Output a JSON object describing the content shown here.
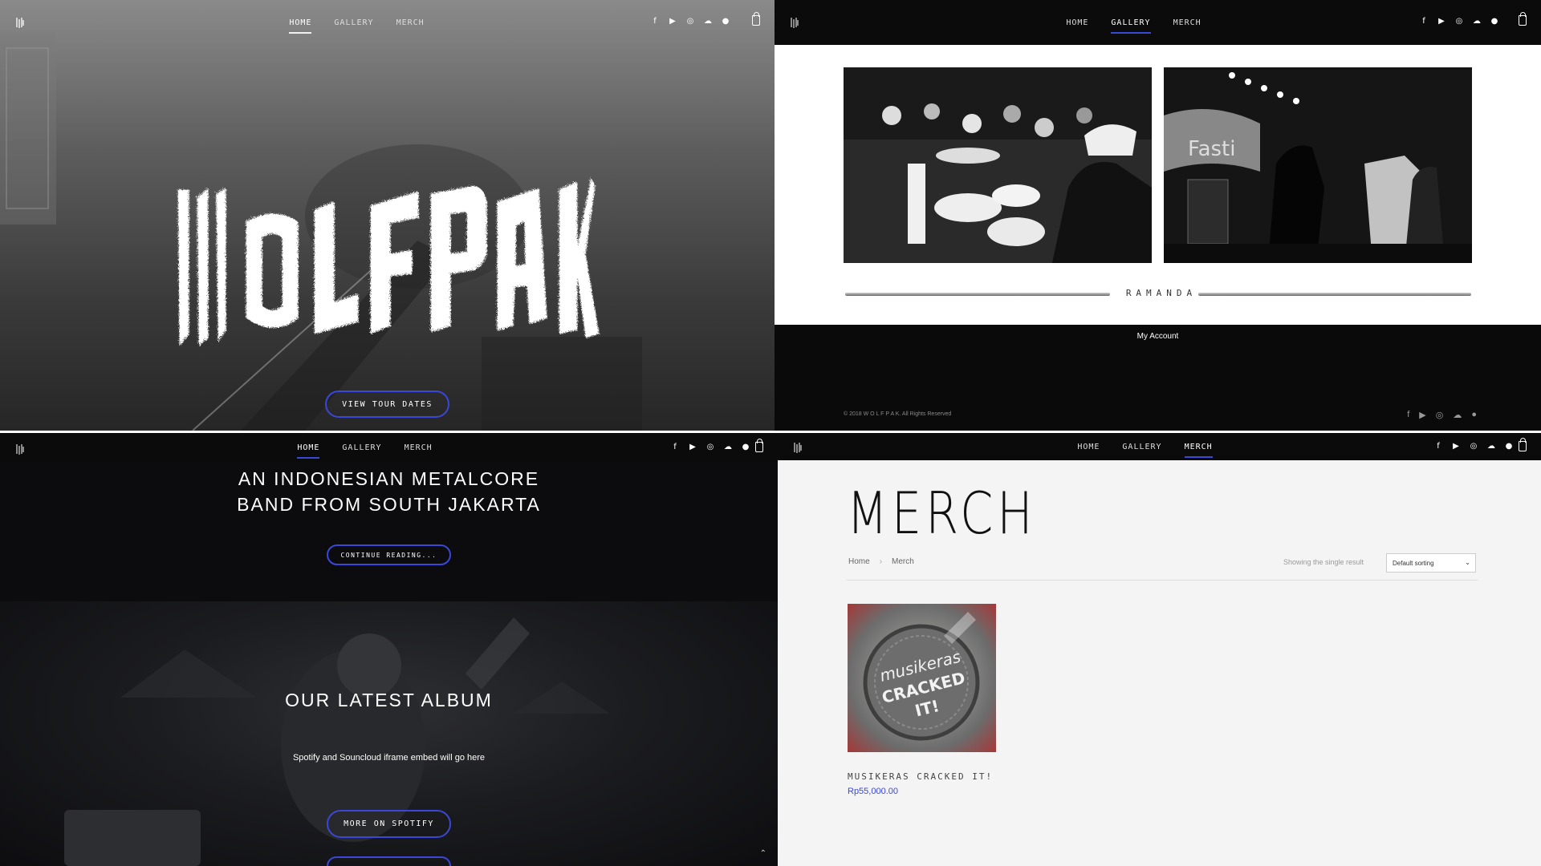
{
  "nav": {
    "items": [
      "HOME",
      "GALLERY",
      "MERCH"
    ],
    "social_icons": [
      "facebook-icon",
      "youtube-icon",
      "instagram-icon",
      "soundcloud-icon",
      "spotify-icon"
    ]
  },
  "hero": {
    "band_name": "WOLFPAK",
    "tour_button": "VIEW TOUR DATES"
  },
  "gallery": {
    "photographer": "RAMANDA",
    "footer_link": "My Account",
    "copyright": "© 2018 W O L F P A K. All Rights Reserved"
  },
  "about": {
    "line1": "AN INDONESIAN METALCORE",
    "line2": "BAND FROM SOUTH JAKARTA",
    "continue_button": "CONTINUE READING...",
    "album_heading": "OUR LATEST ALBUM",
    "embed_note": "Spotify and Souncloud iframe embed will go here",
    "spotify_button": "MORE ON SPOTIFY"
  },
  "merch": {
    "title": "MERCH",
    "breadcrumb_home": "Home",
    "breadcrumb_current": "Merch",
    "result_text": "Showing the single result",
    "sort_label": "Default sorting",
    "product_name": "MUSIKERAS CRACKED IT!",
    "product_price": "Rp55,000.00",
    "cover_text1": "musikeras",
    "cover_text2": "CRACKED",
    "cover_text3": "IT!"
  },
  "colors": {
    "accent": "#3b47d8",
    "dark": "#0b0b0b"
  }
}
